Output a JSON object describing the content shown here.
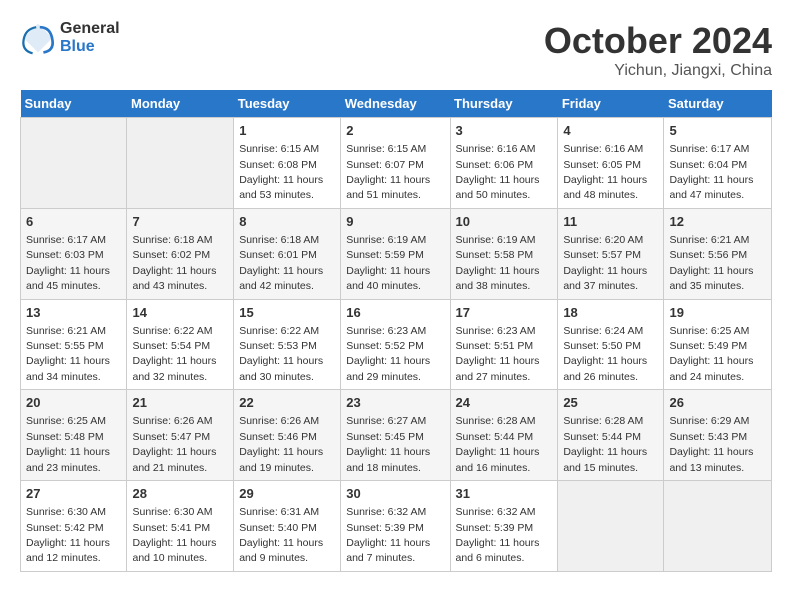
{
  "logo": {
    "line1": "General",
    "line2": "Blue"
  },
  "title": "October 2024",
  "subtitle": "Yichun, Jiangxi, China",
  "days_header": [
    "Sunday",
    "Monday",
    "Tuesday",
    "Wednesday",
    "Thursday",
    "Friday",
    "Saturday"
  ],
  "weeks": [
    [
      {
        "day": "",
        "info": ""
      },
      {
        "day": "",
        "info": ""
      },
      {
        "day": "1",
        "info": "Sunrise: 6:15 AM\nSunset: 6:08 PM\nDaylight: 11 hours and 53 minutes."
      },
      {
        "day": "2",
        "info": "Sunrise: 6:15 AM\nSunset: 6:07 PM\nDaylight: 11 hours and 51 minutes."
      },
      {
        "day": "3",
        "info": "Sunrise: 6:16 AM\nSunset: 6:06 PM\nDaylight: 11 hours and 50 minutes."
      },
      {
        "day": "4",
        "info": "Sunrise: 6:16 AM\nSunset: 6:05 PM\nDaylight: 11 hours and 48 minutes."
      },
      {
        "day": "5",
        "info": "Sunrise: 6:17 AM\nSunset: 6:04 PM\nDaylight: 11 hours and 47 minutes."
      }
    ],
    [
      {
        "day": "6",
        "info": "Sunrise: 6:17 AM\nSunset: 6:03 PM\nDaylight: 11 hours and 45 minutes."
      },
      {
        "day": "7",
        "info": "Sunrise: 6:18 AM\nSunset: 6:02 PM\nDaylight: 11 hours and 43 minutes."
      },
      {
        "day": "8",
        "info": "Sunrise: 6:18 AM\nSunset: 6:01 PM\nDaylight: 11 hours and 42 minutes."
      },
      {
        "day": "9",
        "info": "Sunrise: 6:19 AM\nSunset: 5:59 PM\nDaylight: 11 hours and 40 minutes."
      },
      {
        "day": "10",
        "info": "Sunrise: 6:19 AM\nSunset: 5:58 PM\nDaylight: 11 hours and 38 minutes."
      },
      {
        "day": "11",
        "info": "Sunrise: 6:20 AM\nSunset: 5:57 PM\nDaylight: 11 hours and 37 minutes."
      },
      {
        "day": "12",
        "info": "Sunrise: 6:21 AM\nSunset: 5:56 PM\nDaylight: 11 hours and 35 minutes."
      }
    ],
    [
      {
        "day": "13",
        "info": "Sunrise: 6:21 AM\nSunset: 5:55 PM\nDaylight: 11 hours and 34 minutes."
      },
      {
        "day": "14",
        "info": "Sunrise: 6:22 AM\nSunset: 5:54 PM\nDaylight: 11 hours and 32 minutes."
      },
      {
        "day": "15",
        "info": "Sunrise: 6:22 AM\nSunset: 5:53 PM\nDaylight: 11 hours and 30 minutes."
      },
      {
        "day": "16",
        "info": "Sunrise: 6:23 AM\nSunset: 5:52 PM\nDaylight: 11 hours and 29 minutes."
      },
      {
        "day": "17",
        "info": "Sunrise: 6:23 AM\nSunset: 5:51 PM\nDaylight: 11 hours and 27 minutes."
      },
      {
        "day": "18",
        "info": "Sunrise: 6:24 AM\nSunset: 5:50 PM\nDaylight: 11 hours and 26 minutes."
      },
      {
        "day": "19",
        "info": "Sunrise: 6:25 AM\nSunset: 5:49 PM\nDaylight: 11 hours and 24 minutes."
      }
    ],
    [
      {
        "day": "20",
        "info": "Sunrise: 6:25 AM\nSunset: 5:48 PM\nDaylight: 11 hours and 23 minutes."
      },
      {
        "day": "21",
        "info": "Sunrise: 6:26 AM\nSunset: 5:47 PM\nDaylight: 11 hours and 21 minutes."
      },
      {
        "day": "22",
        "info": "Sunrise: 6:26 AM\nSunset: 5:46 PM\nDaylight: 11 hours and 19 minutes."
      },
      {
        "day": "23",
        "info": "Sunrise: 6:27 AM\nSunset: 5:45 PM\nDaylight: 11 hours and 18 minutes."
      },
      {
        "day": "24",
        "info": "Sunrise: 6:28 AM\nSunset: 5:44 PM\nDaylight: 11 hours and 16 minutes."
      },
      {
        "day": "25",
        "info": "Sunrise: 6:28 AM\nSunset: 5:44 PM\nDaylight: 11 hours and 15 minutes."
      },
      {
        "day": "26",
        "info": "Sunrise: 6:29 AM\nSunset: 5:43 PM\nDaylight: 11 hours and 13 minutes."
      }
    ],
    [
      {
        "day": "27",
        "info": "Sunrise: 6:30 AM\nSunset: 5:42 PM\nDaylight: 11 hours and 12 minutes."
      },
      {
        "day": "28",
        "info": "Sunrise: 6:30 AM\nSunset: 5:41 PM\nDaylight: 11 hours and 10 minutes."
      },
      {
        "day": "29",
        "info": "Sunrise: 6:31 AM\nSunset: 5:40 PM\nDaylight: 11 hours and 9 minutes."
      },
      {
        "day": "30",
        "info": "Sunrise: 6:32 AM\nSunset: 5:39 PM\nDaylight: 11 hours and 7 minutes."
      },
      {
        "day": "31",
        "info": "Sunrise: 6:32 AM\nSunset: 5:39 PM\nDaylight: 11 hours and 6 minutes."
      },
      {
        "day": "",
        "info": ""
      },
      {
        "day": "",
        "info": ""
      }
    ]
  ]
}
